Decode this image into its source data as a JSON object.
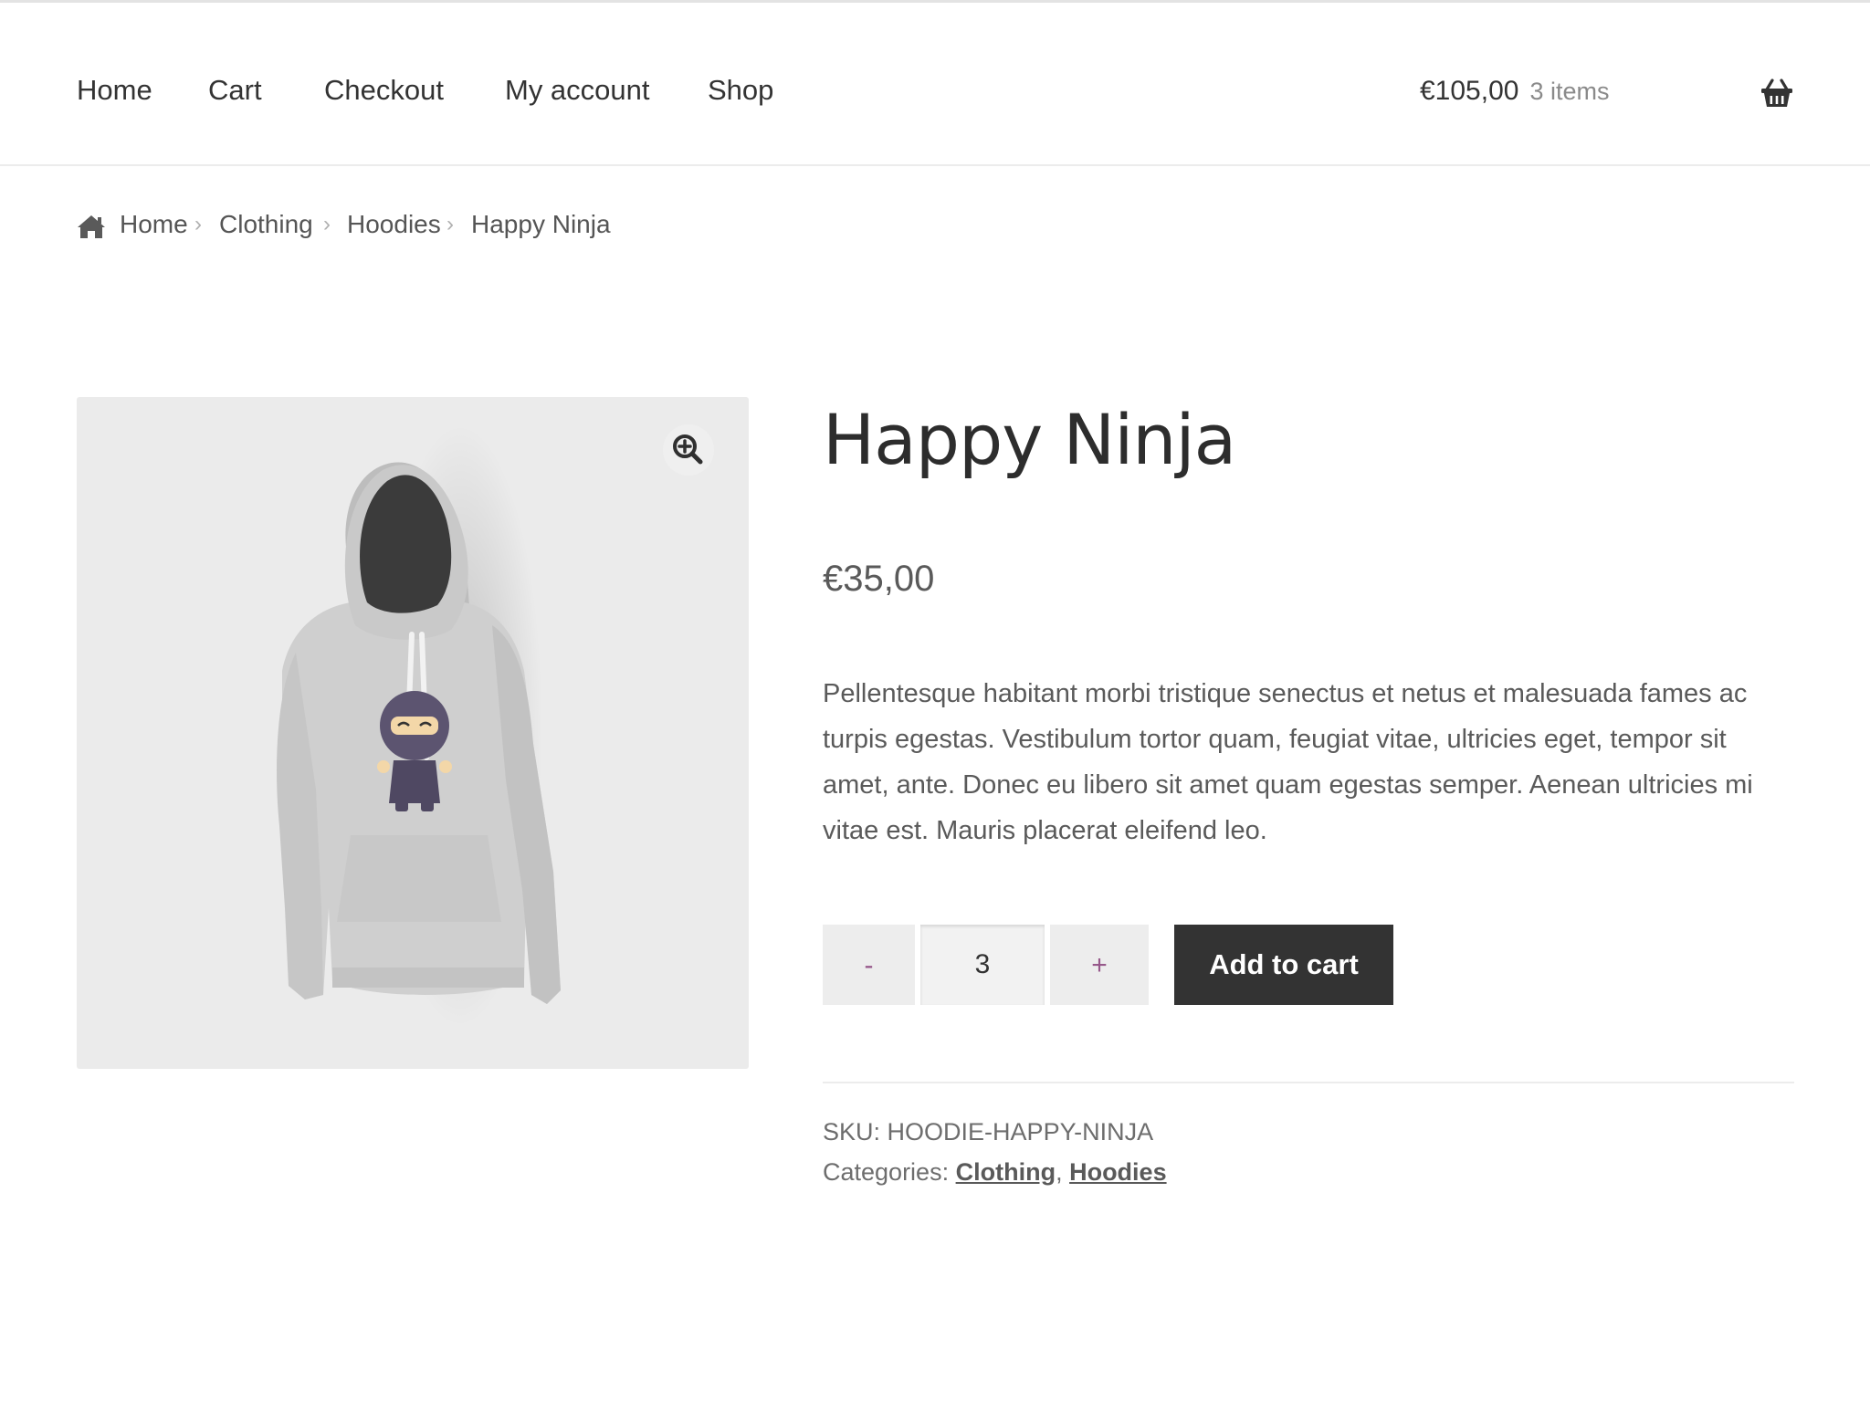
{
  "nav": {
    "items": [
      "Home",
      "Cart",
      "Checkout",
      "My account",
      "Shop"
    ]
  },
  "cart": {
    "amount": "€105,00",
    "count": "3 items",
    "icon": "basket-icon"
  },
  "breadcrumb": {
    "home_icon": "home-icon",
    "items": [
      "Home",
      "Clothing",
      "Hoodies",
      "Happy Ninja"
    ],
    "separator": "›"
  },
  "product": {
    "title": "Happy Ninja",
    "price": "€35,00",
    "description": "Pellentesque habitant morbi tristique senectus et netus et malesuada fames ac turpis egestas. Vestibulum tortor quam, feugiat vitae, ultricies eget, tempor sit amet, ante. Donec eu libero sit amet quam egestas semper. Aenean ultricies mi vitae est. Mauris placerat eleifend leo.",
    "zoom_icon": "zoom-in-icon",
    "quantity": "3",
    "minus_label": "-",
    "plus_label": "+",
    "add_to_cart_label": "Add to cart",
    "sku_label": "SKU:",
    "sku": "HOODIE-HAPPY-NINJA",
    "categories_label": "Categories:",
    "categories": [
      "Clothing",
      "Hoodies"
    ]
  },
  "colors": {
    "accent": "#96588a",
    "button_dark": "#333333",
    "image_bg": "#ebebeb"
  }
}
